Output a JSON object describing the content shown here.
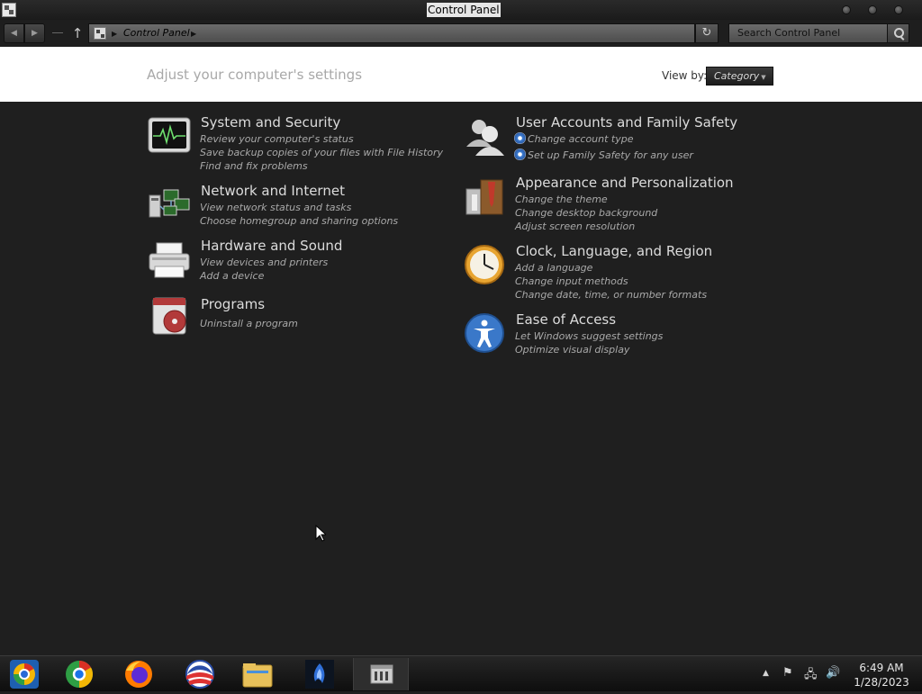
{
  "window": {
    "title": "Control Panel"
  },
  "address": {
    "crumb": "Control Panel",
    "search_placeholder": "Search Control Panel"
  },
  "header": {
    "heading": "Adjust your computer's settings",
    "view_by_label": "View by:",
    "view_by_value": "Category"
  },
  "categories": [
    {
      "title": "System and Security",
      "icon": "system-security-icon",
      "links": [
        "Review your computer's status",
        "Save backup copies of your files with File History",
        "Find and fix problems"
      ]
    },
    {
      "title": "Network and Internet",
      "icon": "network-internet-icon",
      "links": [
        "View network status and tasks",
        "Choose homegroup and sharing options"
      ]
    },
    {
      "title": "Hardware and Sound",
      "icon": "printer-icon",
      "links": [
        "View devices and printers",
        "Add a device"
      ]
    },
    {
      "title": "Programs",
      "icon": "programs-icon",
      "links": [
        "Uninstall a program"
      ]
    },
    {
      "title": "User Accounts and Family Safety",
      "icon": "users-icon",
      "links": [
        "Change account type",
        "Set up Family Safety for any user"
      ]
    },
    {
      "title": "Appearance and Personalization",
      "icon": "appearance-icon",
      "links": [
        "Change the theme",
        "Change desktop background",
        "Adjust screen resolution"
      ]
    },
    {
      "title": "Clock, Language, and Region",
      "icon": "clock-icon",
      "links": [
        "Add a language",
        "Change input methods",
        "Change date, time, or number formats"
      ]
    },
    {
      "title": "Ease of Access",
      "icon": "ease-of-access-icon",
      "links": [
        "Let Windows suggest settings",
        "Optimize visual display"
      ]
    }
  ],
  "taskbar": {
    "apps": [
      "chrome-canary-icon",
      "chrome-icon",
      "firefox-icon",
      "obama-logo-icon",
      "file-explorer-icon",
      "blue-flame-app-icon",
      "control-panel-icon"
    ],
    "clock_time": "6:49 AM",
    "clock_date": "1/28/2023"
  },
  "colors": {
    "background": "#1f1f1f",
    "header_bg": "#ffffff",
    "title_text": "#dcdcdc",
    "link_text": "#a9a9a9"
  }
}
